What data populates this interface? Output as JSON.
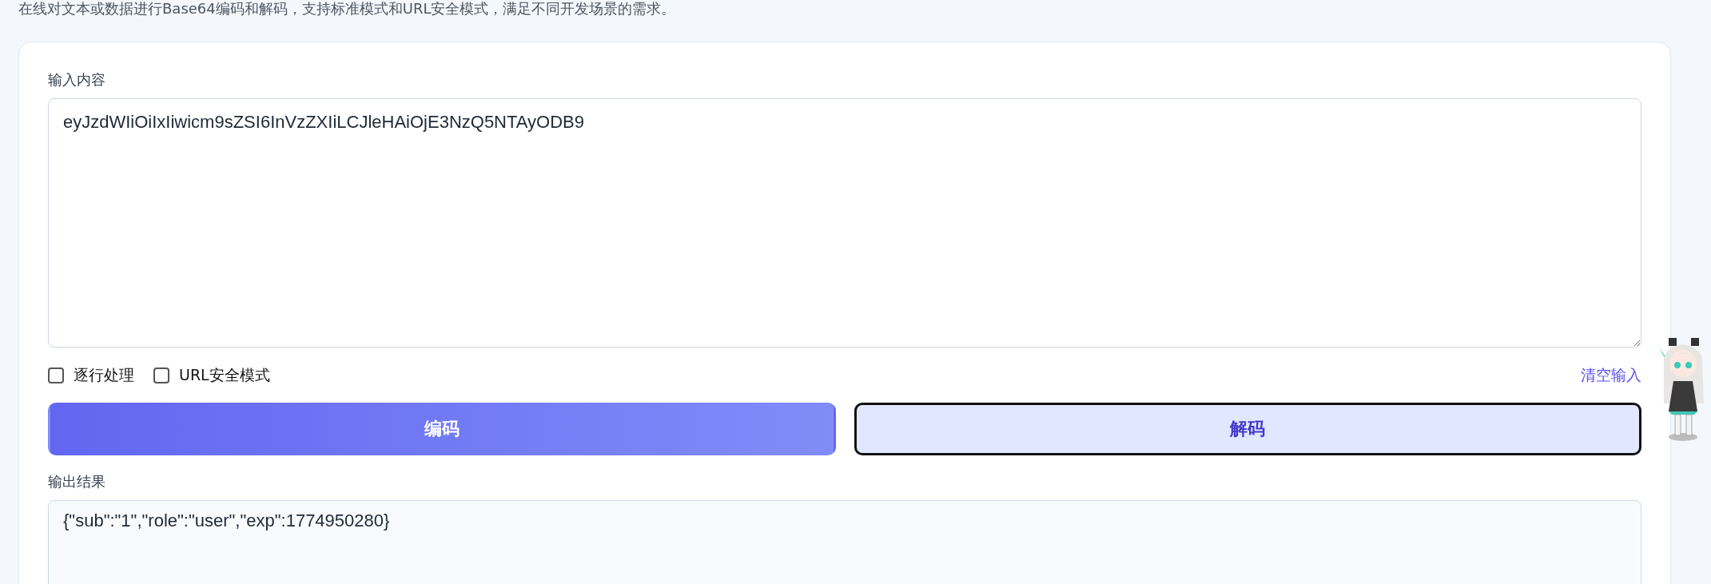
{
  "description": "在线对文本或数据进行Base64编码和解码，支持标准模式和URL安全模式，满足不同开发场景的需求。",
  "input": {
    "label": "输入内容",
    "value": "eyJzdWIiOiIxIiwicm9sZSI6InVzZXIiLCJleHAiOjE3NzQ5NTAyODB9"
  },
  "options": [
    {
      "label": "逐行处理",
      "checked": false
    },
    {
      "label": "URL安全模式",
      "checked": false
    }
  ],
  "clear_link": "清空输入",
  "buttons": [
    {
      "label": "编码",
      "kind": "primary",
      "focused": false
    },
    {
      "label": "解码",
      "kind": "secondary",
      "focused": true
    }
  ],
  "output": {
    "label": "输出结果",
    "value": "{\"sub\":\"1\",\"role\":\"user\",\"exp\":1774950280}"
  }
}
